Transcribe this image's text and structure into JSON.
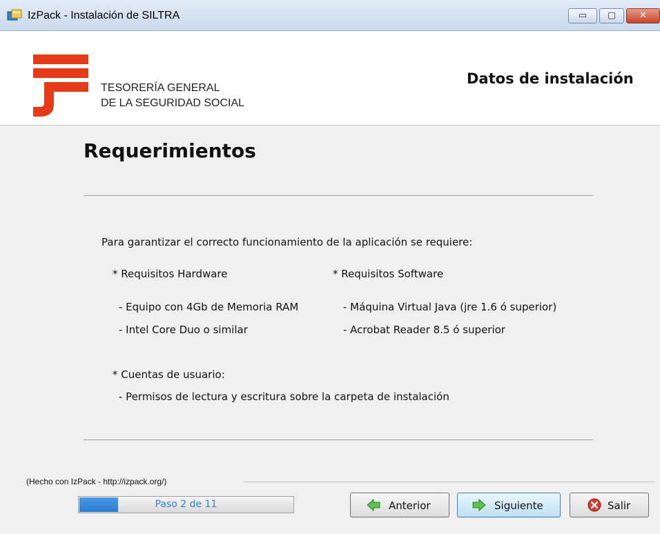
{
  "window": {
    "title": "IzPack - Instalación de  SILTRA",
    "minimize_glyph": "▭",
    "maximize_glyph": "▢",
    "close_glyph": "✕"
  },
  "header": {
    "org_line1": "TESORERÍA GENERAL",
    "org_line2": "DE LA SEGURIDAD SOCIAL",
    "title": "Datos de instalación",
    "logo_color": "#e53a17"
  },
  "content": {
    "section_title": "Requerimientos",
    "intro": "Para garantizar el correcto funcionamiento de la aplicación se requiere:",
    "hardware_heading": "* Requisitos Hardware",
    "software_heading": "* Requisitos Software",
    "hardware_items": [
      "- Equipo con 4Gb de Memoria RAM",
      "- Intel Core Duo o similar"
    ],
    "software_items": [
      "- Máquina Virtual Java (jre 1.6 ó superior)",
      "- Acrobat Reader 8.5 ó superior"
    ],
    "accounts_heading": "* Cuentas de usuario:",
    "accounts_item": "- Permisos de lectura y escritura sobre la carpeta de instalación"
  },
  "footer": {
    "credit": "(Hecho con IzPack - http://izpack.org/)",
    "progress_label": "Paso 2 de 11",
    "progress_fraction": 0.18,
    "back_label": "Anterior",
    "next_label": "Siguiente",
    "exit_label": "Salir",
    "accent_color": "#2f7fd6"
  }
}
